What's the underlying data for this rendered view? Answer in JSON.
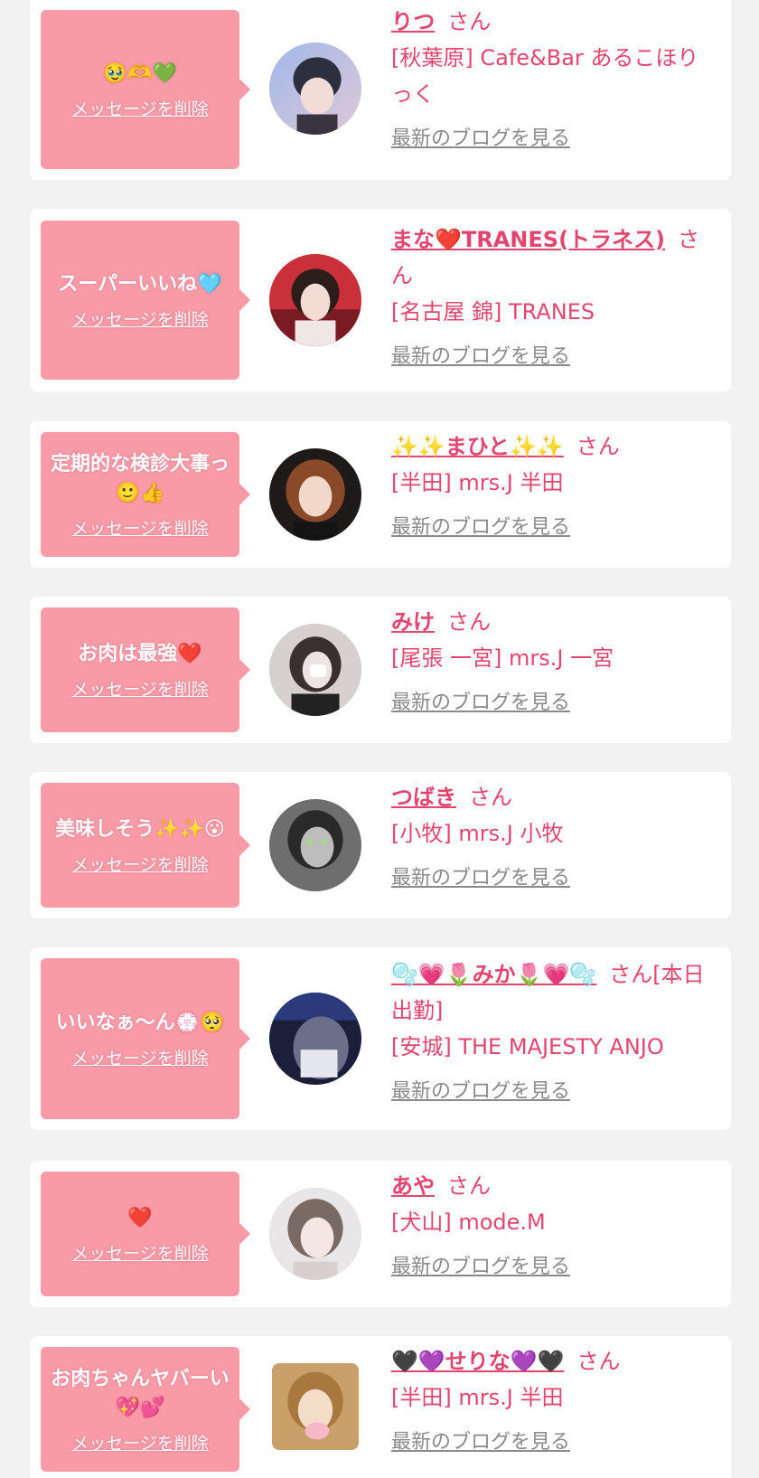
{
  "colors": {
    "accent": "#e4456f",
    "bubble": "#f99aa7",
    "background": "#f2f2f2",
    "card": "#ffffff",
    "link_gray": "#8a8a8a"
  },
  "cards": [
    {
      "message": "🥹🫶💚",
      "delete_label": "メッセージを削除",
      "name": "りつ",
      "suffix": "さん",
      "shop": "[秋葉原] Cafe&Bar あるこほりっく",
      "blog_label": "最新のブログを見る",
      "avatar_icon": "avatar-photo-icon"
    },
    {
      "message": "スーパーいいね🩵",
      "delete_label": "メッセージを削除",
      "name": "まな❤️TRANES(トラネス)",
      "suffix": "さん",
      "shop": "[名古屋 錦] TRANES",
      "blog_label": "最新のブログを見る",
      "avatar_icon": "avatar-photo-icon"
    },
    {
      "message": "定期的な検診大事っ🙂👍",
      "delete_label": "メッセージを削除",
      "name": "✨✨まひと✨✨",
      "suffix": "さん",
      "shop": "[半田] mrs.J 半田",
      "blog_label": "最新のブログを見る",
      "avatar_icon": "avatar-photo-icon"
    },
    {
      "message": "お肉は最強❤️",
      "delete_label": "メッセージを削除",
      "name": "みけ",
      "suffix": "さん",
      "shop": "[尾張 一宮] mrs.J 一宮",
      "blog_label": "最新のブログを見る",
      "avatar_icon": "avatar-photo-icon"
    },
    {
      "message": "美味しそう✨✨😮",
      "delete_label": "メッセージを削除",
      "name": "つばき",
      "suffix": "さん",
      "shop": "[小牧] mrs.J 小牧",
      "blog_label": "最新のブログを見る",
      "avatar_icon": "avatar-photo-icon"
    },
    {
      "message": "いいなぁ〜ん💮🥺",
      "delete_label": "メッセージを削除",
      "name": "🫧💗🌷みか🌷💗🫧",
      "suffix": "さん[本日出勤]",
      "shop": "[安城] THE MAJESTY ANJO",
      "blog_label": "最新のブログを見る",
      "avatar_icon": "avatar-photo-icon"
    },
    {
      "message": "❤️",
      "delete_label": "メッセージを削除",
      "name": "あや",
      "suffix": "さん",
      "shop": "[犬山] mode.M",
      "blog_label": "最新のブログを見る",
      "avatar_icon": "avatar-photo-icon"
    },
    {
      "message": "お肉ちゃんヤバーい💖💕",
      "delete_label": "メッセージを削除",
      "name": "🖤💜せりな💜🖤",
      "suffix": "さん",
      "shop": "[半田] mrs.J 半田",
      "blog_label": "最新のブログを見る",
      "avatar_icon": "avatar-photo-icon"
    }
  ]
}
